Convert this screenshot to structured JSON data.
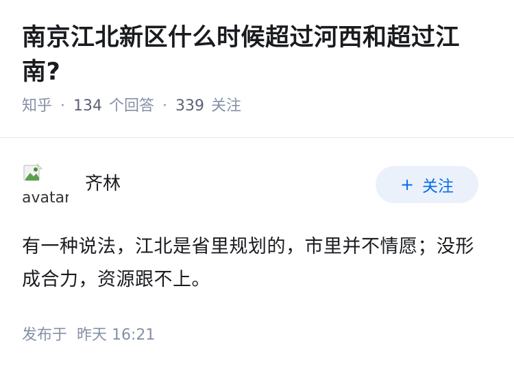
{
  "question": {
    "title": "南京江北新区什么时候超过河西和超过江南?",
    "site": "知乎",
    "separator": "·",
    "answer_count": "134",
    "answer_label": "个回答",
    "follower_count": "339",
    "follower_label": "关注"
  },
  "answer": {
    "avatar_alt": "avatar",
    "author_name": "齐林",
    "follow_button": {
      "icon": "+",
      "label": "关注"
    },
    "content": "有一种说法，江北是省里规划的，市里并不情愿；没形成合力，资源跟不上。",
    "publish_label": "发布于",
    "publish_time": "昨天 16:21"
  },
  "colors": {
    "accent": "#056de8",
    "button_bg": "#ebf1fb",
    "meta_gray": "#8590a6"
  }
}
